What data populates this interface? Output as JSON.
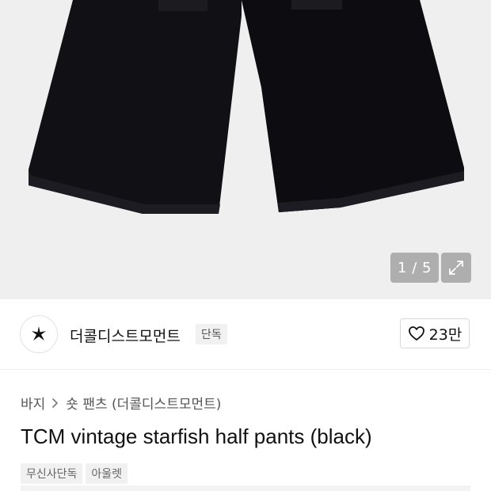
{
  "gallery": {
    "current_page": "1",
    "separator": "/",
    "total_pages": "5",
    "counter_text": "1 / 5"
  },
  "brand": {
    "name": "더콜디스트모먼트",
    "badge": "단독"
  },
  "likes": {
    "count": "23만"
  },
  "breadcrumb": {
    "category": "바지",
    "subcategory": "숏 팬츠 (더콜디스트모먼트)"
  },
  "product": {
    "title": "TCM vintage starfish half pants (black)"
  },
  "tags": [
    "무신사단독",
    "아울렛"
  ],
  "icons": {
    "expand": "expand-icon",
    "heart": "heart-icon",
    "chevron": "chevron-right-icon",
    "brand_logo": "starfish-logo"
  }
}
